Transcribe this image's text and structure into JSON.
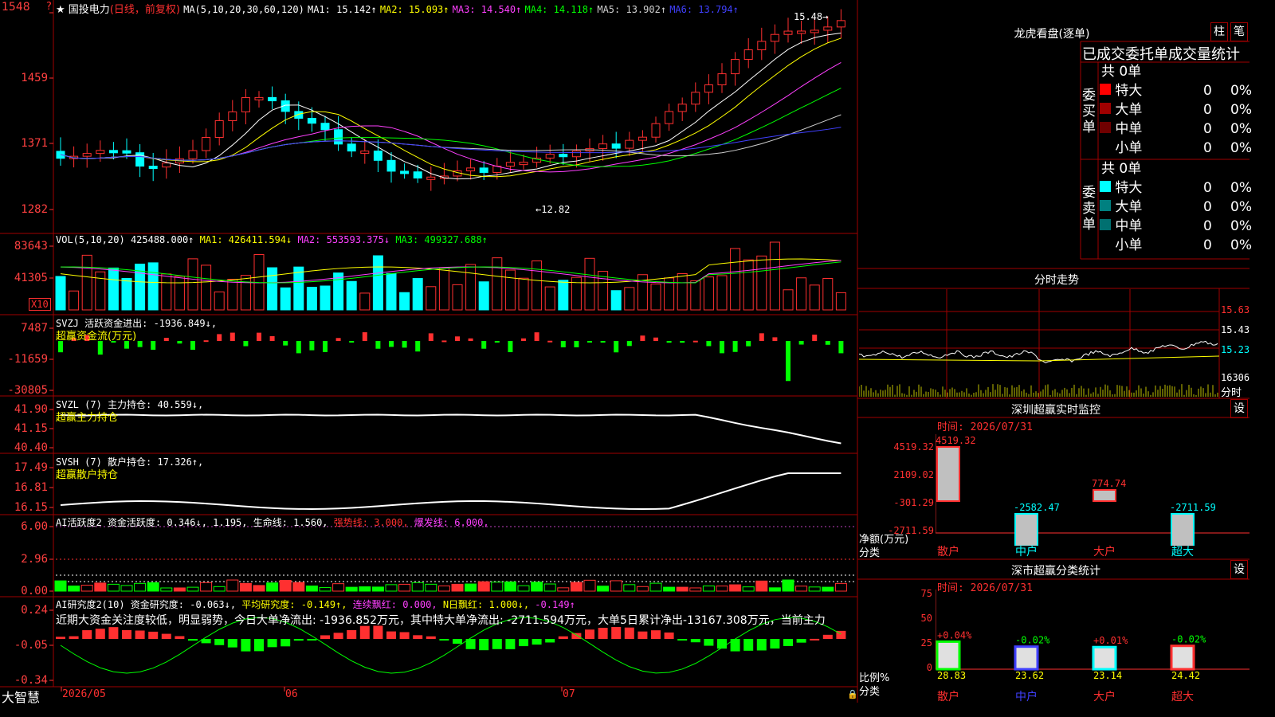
{
  "main_chart": {
    "question_mark": "?",
    "star": "★",
    "stock_name": "国投电力",
    "period": "(日线，前复权)",
    "ma_params": "MA(5,10,20,30,60,120)",
    "ma1": "MA1: 15.142↑",
    "ma2": "MA2: 15.093↑",
    "ma3": "MA3: 14.540↑",
    "ma4": "MA4: 14.118↑",
    "ma5": "MA5: 13.902↑",
    "ma6": "MA6: 13.794↑",
    "high_note": "15.48→",
    "low_note": "←12.82",
    "y_labels": [
      "1548",
      "1459",
      "1371",
      "1282"
    ]
  },
  "volume": {
    "title": "VOL(5,10,20)",
    "value": "425488.000↑",
    "ma1": "MA1: 426411.594↓",
    "ma2": "MA2: 553593.375↓",
    "ma3": "MA3: 499327.688↑",
    "y_labels": [
      "83643",
      "41305"
    ],
    "unit_badge": "X10"
  },
  "svzj": {
    "title": "SVZJ  活跃资金进出: -1936.849↓,",
    "subtitle": "超赢资金流(万元)",
    "y_labels": [
      "7487",
      "-11659",
      "-30805"
    ]
  },
  "svzl": {
    "title": "SVZL (7) 主力持仓: 40.559↓,",
    "subtitle": "超赢主力持仓",
    "y_labels": [
      "41.90",
      "41.15",
      "40.40"
    ]
  },
  "svsh": {
    "title": "SVSH (7) 散户持仓: 17.326↑,",
    "subtitle": "超赢散户持仓",
    "y_labels": [
      "17.49",
      "16.81",
      "16.15"
    ]
  },
  "ai_active": {
    "title": "AI活跃度2 资金活跃度: 0.346↓, 1.195, 生命线: 1.560,",
    "strong": "强势线: 3.000,",
    "burst": "爆发线: 6.000,",
    "y_labels": [
      "6.00",
      "2.96",
      "0.00"
    ]
  },
  "ai_research": {
    "title": "AI研究度2(10) 资金研究度: -0.063↓,",
    "avg": "平均研究度: -0.149↑,",
    "streak": "连续飘红: 0.000,",
    "nday": "N日飘红: 1.000↓,",
    "tail": "-0.149↑",
    "summary": "近期大资金关注度较低，明显弱势，今日大单净流出: -1936.852万元，其中特大单净流出: -2711.594万元，大单5日累计净出-13167.308万元，当前主力",
    "y_labels": [
      "0.24",
      "-0.05",
      "-0.34"
    ]
  },
  "bottom": {
    "logo": "大智慧",
    "date1": "2026/05",
    "date2": "06",
    "date3": "07"
  },
  "dragon": {
    "title": "龙虎看盘(逐单)",
    "btn1": "柱",
    "btn2": "笔",
    "header": "已成交委托单成交量统计",
    "buy_label": "委买单",
    "sell_label": "委卖单",
    "buy_total": "共 0单",
    "sell_total": "共 0单",
    "buy_rows": [
      {
        "name": "特大",
        "count": "0",
        "pct": "0%",
        "color": "#ff0000"
      },
      {
        "name": "大单",
        "count": "0",
        "pct": "0%",
        "color": "#a00000"
      },
      {
        "name": "中单",
        "count": "0",
        "pct": "0%",
        "color": "#700000"
      },
      {
        "name": "小单",
        "count": "0",
        "pct": "0%",
        "color": "#000000"
      }
    ],
    "sell_rows": [
      {
        "name": "特大",
        "count": "0",
        "pct": "0%",
        "color": "#00ffff"
      },
      {
        "name": "大单",
        "count": "0",
        "pct": "0%",
        "color": "#008080"
      },
      {
        "name": "中单",
        "count": "0",
        "pct": "0%",
        "color": "#007070"
      },
      {
        "name": "小单",
        "count": "0",
        "pct": "0%",
        "color": "#000000"
      }
    ]
  },
  "intraday": {
    "title": "分时走势",
    "y_labels": [
      "15.63",
      "15.43",
      "15.23"
    ],
    "vol_label": "16306",
    "minute_label": "分时"
  },
  "shenzhen_monitor": {
    "title": "深圳超赢实时监控",
    "set": "设",
    "time": "时间: 2026/07/31",
    "y_labels": [
      "4519.32",
      "2109.02",
      "-301.29",
      "-2711.59"
    ],
    "y_title": "净额(万元)",
    "x_title": "分类",
    "categories": [
      "散户",
      "中户",
      "大户",
      "超大"
    ],
    "values": [
      "4519.32",
      "-2582.47",
      "774.74",
      "-2711.59"
    ]
  },
  "classification": {
    "title": "深市超赢分类统计",
    "set": "设",
    "time": "时间: 2026/07/31",
    "y_labels": [
      "75",
      "50",
      "25",
      "0"
    ],
    "y_title": "比例%",
    "x_title": "分类",
    "categories": [
      "散户",
      "中户",
      "大户",
      "超大"
    ],
    "changes": [
      "+0.04%",
      "-0.02%",
      "+0.01%",
      "-0.02%"
    ],
    "values": [
      "28.83",
      "23.62",
      "23.14",
      "24.42"
    ]
  }
}
